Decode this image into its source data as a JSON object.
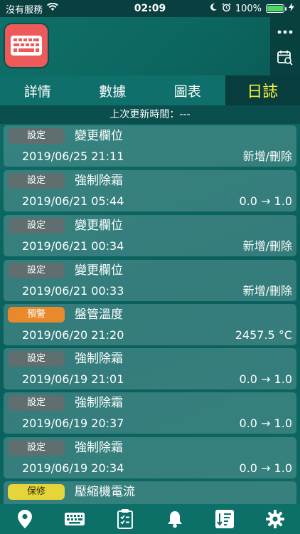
{
  "status": {
    "carrier": "沒有服務",
    "time": "02:09",
    "battery": "100%"
  },
  "tabs": [
    {
      "label": "詳情"
    },
    {
      "label": "數據"
    },
    {
      "label": "圖表"
    },
    {
      "label": "日誌"
    }
  ],
  "last_update": "上次更新時間：---",
  "log": [
    {
      "badge": "設定",
      "title": "變更欄位",
      "time": "2019/06/25 21:11",
      "value": "新增/刪除"
    },
    {
      "badge": "設定",
      "title": "強制除霜",
      "time": "2019/06/21 05:44",
      "value": "0.0 → 1.0"
    },
    {
      "badge": "設定",
      "title": "變更欄位",
      "time": "2019/06/21 00:34",
      "value": "新增/刪除"
    },
    {
      "badge": "設定",
      "title": "變更欄位",
      "time": "2019/06/21 00:33",
      "value": "新增/刪除"
    },
    {
      "badge": "預警",
      "title": "盤管溫度",
      "time": "2019/06/20 21:20",
      "value": "2457.5 °C"
    },
    {
      "badge": "設定",
      "title": "強制除霜",
      "time": "2019/06/19 21:01",
      "value": "0.0 → 1.0"
    },
    {
      "badge": "設定",
      "title": "強制除霜",
      "time": "2019/06/19 20:37",
      "value": "0.0 → 1.0"
    },
    {
      "badge": "設定",
      "title": "強制除霜",
      "time": "2019/06/19 20:34",
      "value": "0.0 → 1.0"
    },
    {
      "badge": "保修",
      "title": "壓縮機電流",
      "time": "",
      "value": ""
    }
  ],
  "icons": {
    "app": "keyboard-icon",
    "menu": "more-dots-icon",
    "calendar": "calendar-search-icon",
    "nav": [
      "location-pin-icon",
      "keyboard-icon",
      "clipboard-check-icon",
      "bell-icon",
      "sort-list-icon",
      "gear-icon"
    ]
  },
  "colors": {
    "active_tab_text": "#f6ee3d",
    "badge_setting": "#5f6e6e",
    "badge_warning": "#e8892c",
    "badge_maintenance": "#e6d43b",
    "app_icon": "#ee5a5a"
  }
}
